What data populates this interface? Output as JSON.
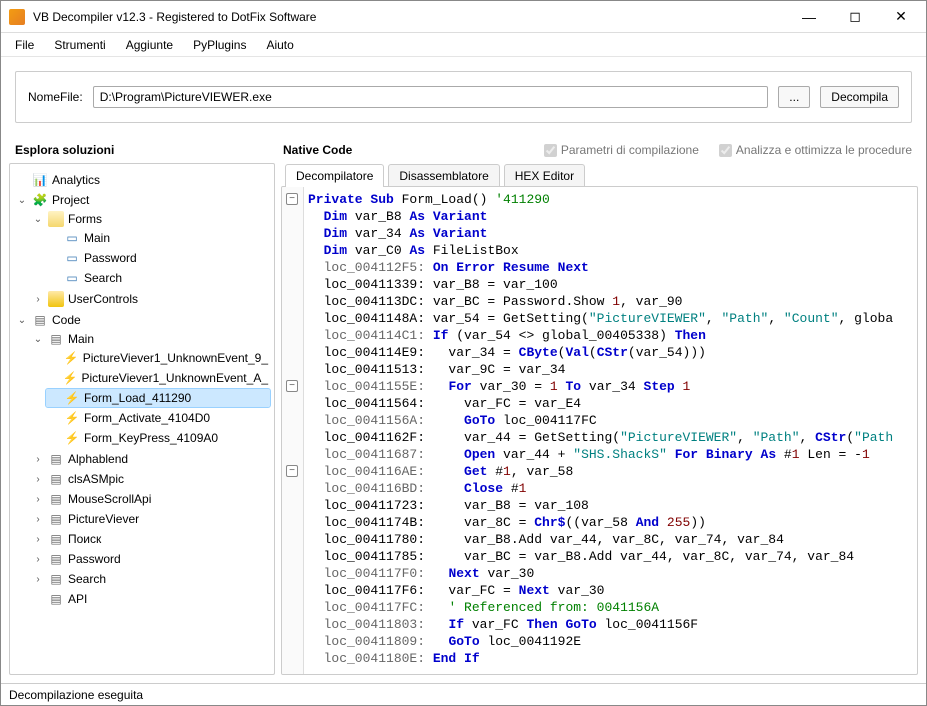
{
  "window": {
    "title": "VB Decompiler v12.3 - Registered to DotFix Software"
  },
  "menu": [
    "File",
    "Strumenti",
    "Aggiunte",
    "PyPlugins",
    "Aiuto"
  ],
  "toolbar": {
    "filelabel": "NomeFile:",
    "filepath": "D:\\Program\\PictureVIEWER.exe",
    "browse": "...",
    "decompile": "Decompila"
  },
  "subheader": {
    "explorer": "Esplora soluzioni",
    "native": "Native Code",
    "chk_params": "Parametri di compilazione",
    "chk_opt": "Analizza e ottimizza le procedure"
  },
  "tabs": [
    "Decompilatore",
    "Disassemblatore",
    "HEX Editor"
  ],
  "tree": {
    "analytics": "Analytics",
    "project": "Project",
    "forms": "Forms",
    "main": "Main",
    "password": "Password",
    "search": "Search",
    "usercontrols": "UserControls",
    "code": "Code",
    "code_main": "Main",
    "pv_unknown9": "PictureViever1_UnknownEvent_9_",
    "pv_unknownA": "PictureViever1_UnknownEvent_A_",
    "formload": "Form_Load_411290",
    "formactivate": "Form_Activate_4104D0",
    "formkeypress": "Form_KeyPress_4109A0",
    "alphablend": "Alphablend",
    "clsasmpic": "clsASMpic",
    "mousescrollapi": "MouseScrollApi",
    "pictureviever": "PictureViever",
    "poisk": "Поиск",
    "code_password": "Password",
    "code_search": "Search",
    "api": "API"
  },
  "code": {
    "l1a": "Private Sub",
    "l1b": " Form_Load",
    "l1c": "() ",
    "l1d": "'411290",
    "l2a": "Dim",
    "l2b": " var_B8 ",
    "l2c": "As Variant",
    "l3a": "Dim",
    "l3b": " var_34 ",
    "l3c": "As Variant",
    "l4a": "Dim",
    "l4b": " var_C0 ",
    "l4c": "As",
    "l4d": " FileListBox",
    "l5a": "  loc_004112F5: ",
    "l5b": "On Error Resume Next",
    "l6a": "  loc_00411339: var_B8 = var_100",
    "l7a": "  loc_004113DC: var_BC = Password.Show ",
    "l7b": "1",
    "l7c": ", var_90",
    "l8a": "  loc_0041148A: var_54 = GetSetting(",
    "l8b": "\"PictureVIEWER\"",
    "l8c": ", ",
    "l8d": "\"Path\"",
    "l8e": ", ",
    "l8f": "\"Count\"",
    "l8g": ", globa",
    "l9a": "  loc_004114C1: ",
    "l9b": "If",
    "l9c": " (var_54 <> global_00405338) ",
    "l9d": "Then",
    "l10a": "  loc_004114E9:   var_34 = ",
    "l10b": "CByte",
    "l10c": "(",
    "l10d": "Val",
    "l10e": "(",
    "l10f": "CStr",
    "l10g": "(var_54)))",
    "l11a": "  loc_00411513:   var_9C = var_34",
    "l12a": "  loc_0041155E:   ",
    "l12b": "For",
    "l12c": " var_30 = ",
    "l12d": "1",
    "l12e": " ",
    "l12f": "To",
    "l12g": " var_34 ",
    "l12h": "Step",
    "l12i": " ",
    "l12j": "1",
    "l13a": "  loc_00411564:     var_FC = var_E4",
    "l14a": "  loc_0041156A:     ",
    "l14b": "GoTo",
    "l14c": " loc_004117FC",
    "l15a": "  loc_0041162F:     var_44 = GetSetting(",
    "l15b": "\"PictureVIEWER\"",
    "l15c": ", ",
    "l15d": "\"Path\"",
    "l15e": ", ",
    "l15f": "CStr",
    "l15g": "(",
    "l15h": "\"Path",
    "l16a": "  loc_00411687:     ",
    "l16b": "Open",
    "l16c": " var_44 + ",
    "l16d": "\"SHS.ShackS\"",
    "l16e": " ",
    "l16f": "For Binary As",
    "l16g": " #",
    "l16h": "1",
    "l16i": " Len = -",
    "l16j": "1",
    "l17a": "  loc_004116AE:     ",
    "l17b": "Get",
    "l17c": " #",
    "l17d": "1",
    "l17e": ", var_58",
    "l18a": "  loc_004116BD:     ",
    "l18b": "Close",
    "l18c": " #",
    "l18d": "1",
    "l19a": "  loc_00411723:     var_B8 = var_108",
    "l20a": "  loc_0041174B:     var_8C = ",
    "l20b": "Chr$",
    "l20c": "((var_58 ",
    "l20d": "And",
    "l20e": " ",
    "l20f": "255",
    "l20g": "))",
    "l21a": "  loc_00411780:     var_B8.Add var_44, var_8C, var_74, var_84",
    "l22a": "  loc_00411785:     var_BC = var_B8.Add var_44, var_8C, var_74, var_84",
    "l23a": "  loc_004117F0:   ",
    "l23b": "Next",
    "l23c": " var_30",
    "l24a": "  loc_004117F6:   var_FC = ",
    "l24b": "Next",
    "l24c": " var_30",
    "l25a": "  loc_004117FC:   ",
    "l25b": "' Referenced from: 0041156A",
    "l26a": "  loc_00411803:   ",
    "l26b": "If",
    "l26c": " var_FC ",
    "l26d": "Then GoTo",
    "l26e": " loc_0041156F",
    "l27a": "  loc_00411809:   ",
    "l27b": "GoTo",
    "l27c": " loc_0041192E",
    "l28a": "  loc_0041180E: ",
    "l28b": "End If"
  },
  "status": "Decompilazione eseguita"
}
